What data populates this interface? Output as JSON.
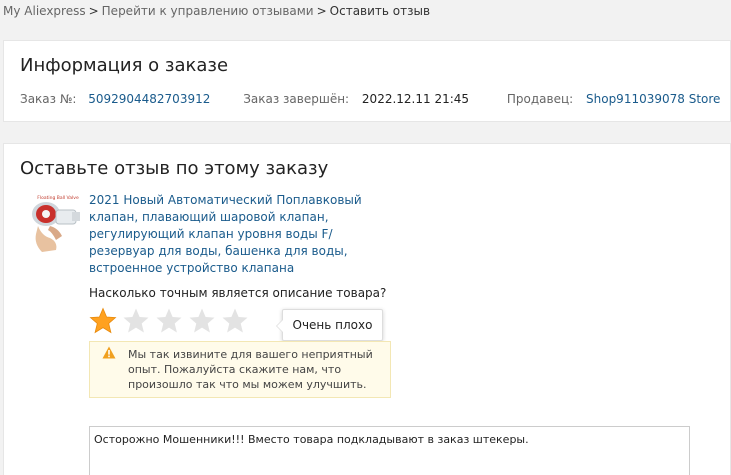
{
  "breadcrumb": {
    "root": "My Aliexpress",
    "separator": ">",
    "manage": "Перейти к управлению отзывами",
    "current": "Оставить отзыв"
  },
  "order_info": {
    "title": "Информация о заказе",
    "order_no_label": "Заказ №:",
    "order_no": "5092904482703912",
    "completed_label": "Заказ завершён:",
    "completed_at": "2022.12.11 21:45",
    "seller_label": "Продавец:",
    "seller": "Shop911039078 Store"
  },
  "review": {
    "title": "Оставьте отзыв по этому заказу",
    "thumb_caption": "Floating Ball Valve",
    "product_title": "2021 Новый Автоматический Поплавковый клапан, плавающий шаровой клапан, регулирующий клапан уровня воды F/резервуар для воды, башенка для воды, встроенное устройство клапана",
    "question": "Насколько точным является описание товара?",
    "rating": 1,
    "rating_max": 5,
    "tooltip": "Очень плохо",
    "warning": "Мы так извините для вашего неприятный опыт. Пожалуйста скажите нам, что произошло так что мы можем улучшить.",
    "text": "Осторожно Мошенники!!! Вместо товара подкладывают в заказ штекеры."
  },
  "colors": {
    "star_active": "#ffa11f",
    "star_inactive": "#e3e3e3",
    "warning_icon": "#f0a020",
    "link": "#1a5b8c"
  }
}
